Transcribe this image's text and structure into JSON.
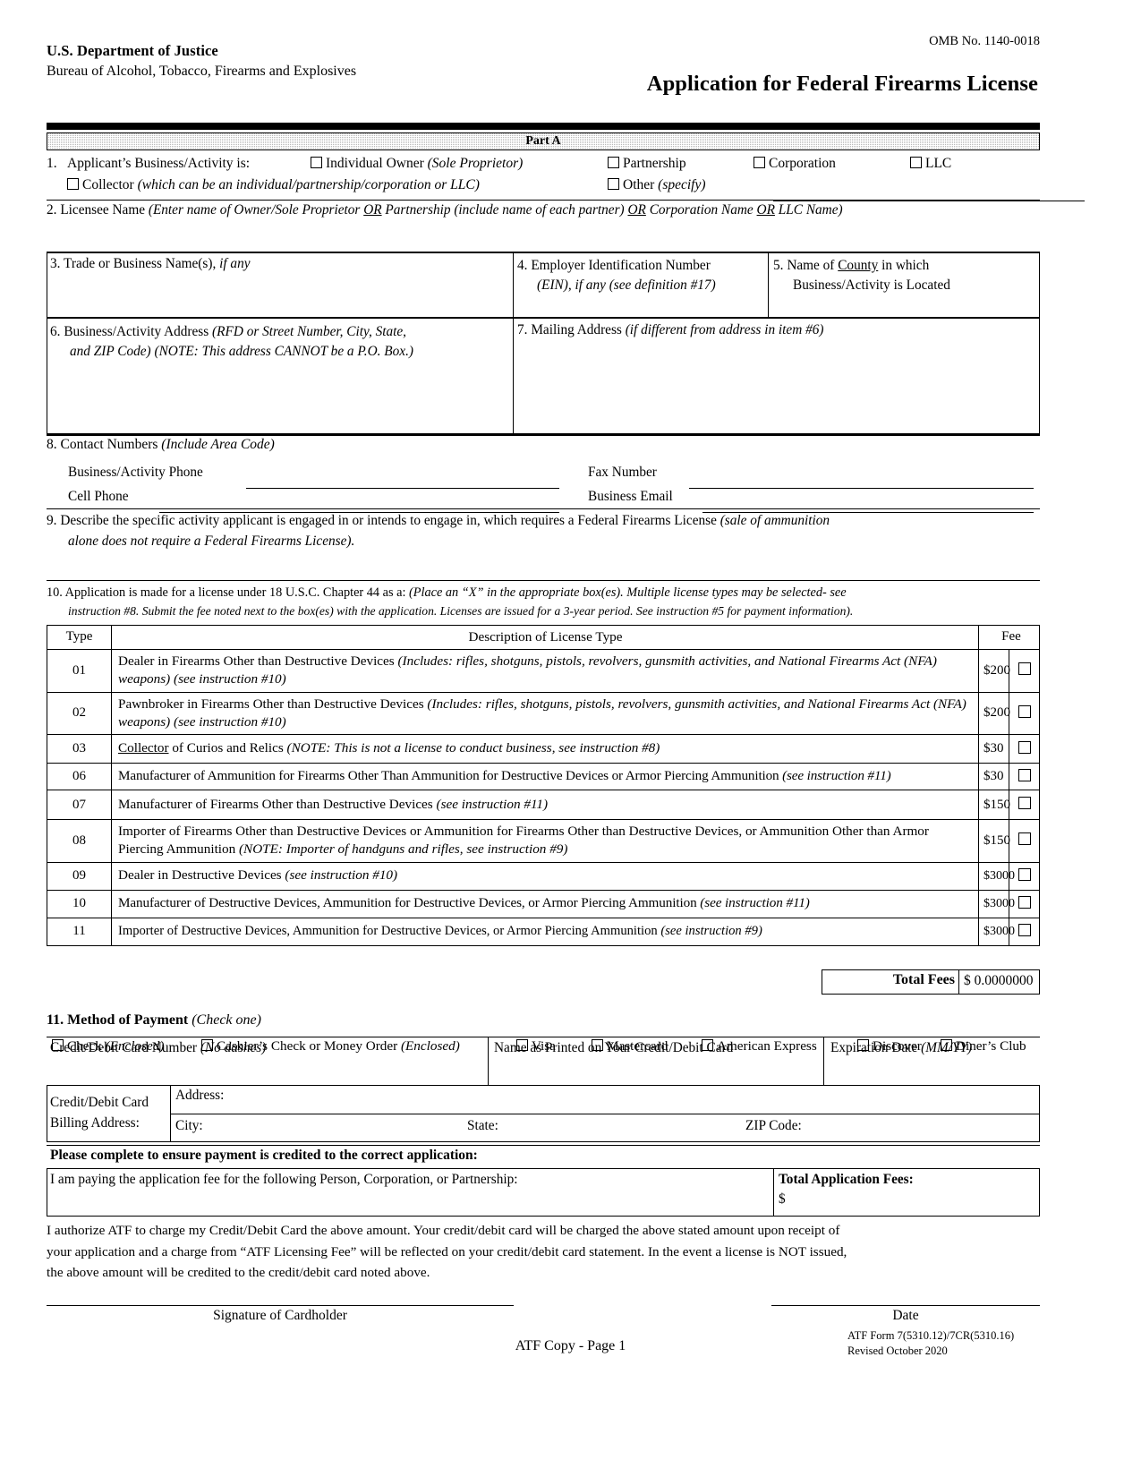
{
  "header": {
    "agency": "U.S. Department of Justice",
    "bureau": "Bureau of Alcohol, Tobacco, Firearms and Explosives",
    "omb": "OMB No. 1140-0018",
    "title": "Application for Federal Firearms License",
    "part_label": "Part A"
  },
  "item1": {
    "number": "1.",
    "prompt": "Applicant’s Business/Activity is:",
    "options_row1": [
      {
        "label": "Individual Owner",
        "note": "(Sole Proprietor)"
      },
      {
        "label": "Partnership",
        "note": ""
      },
      {
        "label": "Corporation",
        "note": ""
      },
      {
        "label": "LLC",
        "note": ""
      }
    ],
    "collector_label": "Collector",
    "collector_note": "(which can be an individual/partnership/corporation or LLC)",
    "other_label": "Other",
    "other_note": "(specify)"
  },
  "item2": {
    "number": "2.",
    "label": "Licensee Name",
    "note_a": "(Enter name of Owner/Sole Proprietor ",
    "note_or1": "OR",
    "note_b": " Partnership (include name of each partner) ",
    "note_or2": "OR",
    "note_c": " Corporation Name ",
    "note_or3": "OR",
    "note_d": " LLC Name)"
  },
  "item3": {
    "number": "3.",
    "label": "Trade or Business Name(s),",
    "note": "if any"
  },
  "item4": {
    "number": "4.",
    "label": "Employer Identification Number",
    "note": "(EIN), if any (see definition #17)"
  },
  "item5": {
    "number": "5.",
    "label_a": "Name of ",
    "label_county": "County",
    "label_b": " in which",
    "label2": "Business/Activity is Located"
  },
  "item6": {
    "number": "6.",
    "label": "Business/Activity Address",
    "note_l1": "(RFD or Street Number, City, State,",
    "note_l2": "and ZIP Code)  (NOTE:  This address CANNOT be a P.O. Box.)"
  },
  "item7": {
    "number": "7.",
    "label": "Mailing Address",
    "note": "(if different from address in item #6)"
  },
  "item8": {
    "number": "8.",
    "label": "Contact Numbers",
    "note": "(Include Area Code)",
    "fields": [
      {
        "label": "Business/Activity Phone"
      },
      {
        "label": "Fax Number"
      },
      {
        "label": "Cell Phone"
      },
      {
        "label": "Business Email"
      }
    ]
  },
  "item9": {
    "number": "9.",
    "text_l1": "Describe the specific activity applicant is engaged in or intends to engage in, which requires a Federal Firearms License ",
    "note_l1": "(sale of ammunition",
    "note_l2": "alone does not require a Federal Firearms License)."
  },
  "item10": {
    "number": "10.",
    "text": "Application is made for a license under 18 U.S.C. Chapter 44 as a:",
    "note_l1": "(Place an “X” in the appropriate box(es).  Multiple license types may be selected- see",
    "note_l2": "instruction #8. Submit the fee noted next to the box(es) with the application.  Licenses are issued for a 3-year period.  See instruction #5 for payment information)."
  },
  "license_table": {
    "headers": {
      "type": "Type",
      "description": "Description of License Type",
      "fee": "Fee"
    },
    "rows": [
      {
        "type": "01",
        "desc_main": "Dealer in Firearms Other than Destructive Devices ",
        "desc_italic": "(Includes:  rifles, shotguns, pistols, revolvers, gunsmith activities, and National Firearms Act (NFA) weapons) (see instruction #10)",
        "fee": "$200",
        "size": "normal"
      },
      {
        "type": "02",
        "desc_main": "Pawnbroker in Firearms Other than Destructive Devices ",
        "desc_italic": "(Includes:  rifles, shotguns, pistols, revolvers, gunsmith activities, and National Firearms Act (NFA) weapons) (see instruction #10)",
        "fee": "$200",
        "size": "normal"
      },
      {
        "type": "03",
        "desc_underline": "Collector",
        "desc_main": " of Curios and Relics ",
        "desc_italic": "(NOTE:  This is not a license to conduct business, see instruction #8)",
        "fee": "$30",
        "size": "normal"
      },
      {
        "type": "06",
        "desc_main": "Manufacturer of Ammunition for Firearms Other Than Ammunition for Destructive Devices or Armor Piercing Ammunition ",
        "desc_italic": "(see instruction #11)",
        "fee": "$30",
        "size": "tiny"
      },
      {
        "type": "07",
        "desc_main": "Manufacturer of Firearms Other than Destructive Devices ",
        "desc_italic": "(see instruction #11)",
        "fee": "$150",
        "size": "normal"
      },
      {
        "type": "08",
        "desc_main": "Importer of Firearms Other than Destructive Devices or Ammunition for Firearms Other than Destructive Devices, or Ammunition Other than Armor Piercing Ammunition ",
        "desc_italic": "(NOTE:  Importer of handguns and rifles, see instruction #9)",
        "fee": "$150",
        "size": "normal"
      },
      {
        "type": "09",
        "desc_main": "Dealer in Destructive Devices ",
        "desc_italic": "(see instruction #10)",
        "fee": "$3000",
        "size": "normal"
      },
      {
        "type": "10",
        "desc_main": "Manufacturer of Destructive Devices, Ammunition for Destructive Devices, or Armor Piercing Ammunition ",
        "desc_italic": "(see instruction #11)",
        "fee": "$3000",
        "size": "small"
      },
      {
        "type": "11",
        "desc_main": "Importer of Destructive Devices, Ammunition for Destructive Devices, or Armor Piercing Ammunition ",
        "desc_italic": "(see instruction #9)",
        "fee": "$3000",
        "size": "normal"
      }
    ],
    "total_fees_label": "Total Fees",
    "total_fees_value": "$  0.0000000"
  },
  "item11": {
    "number": "11.",
    "label": "Method of Payment",
    "note": "(Check one)",
    "options": [
      {
        "label": "Check ",
        "note": "(Enclosed)"
      },
      {
        "label": "Cashier’s Check or Money Order ",
        "note": "(Enclosed)"
      },
      {
        "label": "Visa",
        "note": ""
      },
      {
        "label": "Mastercard",
        "note": ""
      },
      {
        "label": "American Express",
        "note": ""
      },
      {
        "label": "Discover",
        "note": ""
      },
      {
        "label": "Diner’s Club",
        "note": ""
      }
    ]
  },
  "card_fields": {
    "number_label": "Credit/Debit Card Number ",
    "number_note": "(No dashes)",
    "name_label": "Name as Printed on Your Credit/Debit Card",
    "exp_label": "Expiration Date ",
    "exp_note": "(MM/YY)"
  },
  "billing": {
    "title_l1": "Credit/Debit Card",
    "title_l2": "Billing Address:",
    "address_label": "Address:",
    "city_label": "City:",
    "state_label": "State:",
    "zip_label": "ZIP Code:"
  },
  "payment_credit": {
    "notice": "Please complete to ensure payment is credited to the correct application:",
    "paying_for_label": "I am paying the application fee for the following Person, Corporation, or Partnership:",
    "total_app_fees_label": "Total Application Fees:",
    "total_app_fees_value": "$"
  },
  "authorization": {
    "line1": "I authorize ATF to charge my Credit/Debit Card the above amount.  Your credit/debit card will be charged the above stated amount upon receipt of",
    "line2": "your application and a charge from “ATF Licensing Fee” will be reflected on your credit/debit card statement.  In the event a license is NOT issued,",
    "line3": "the above amount will be credited to the credit/debit card noted above."
  },
  "footer": {
    "signature_label": "Signature of Cardholder",
    "date_label": "Date",
    "copy_label": "ATF Copy - Page 1",
    "form_line1": "ATF Form 7(5310.12)/7CR(5310.16)",
    "form_line2": "Revised October 2020"
  }
}
